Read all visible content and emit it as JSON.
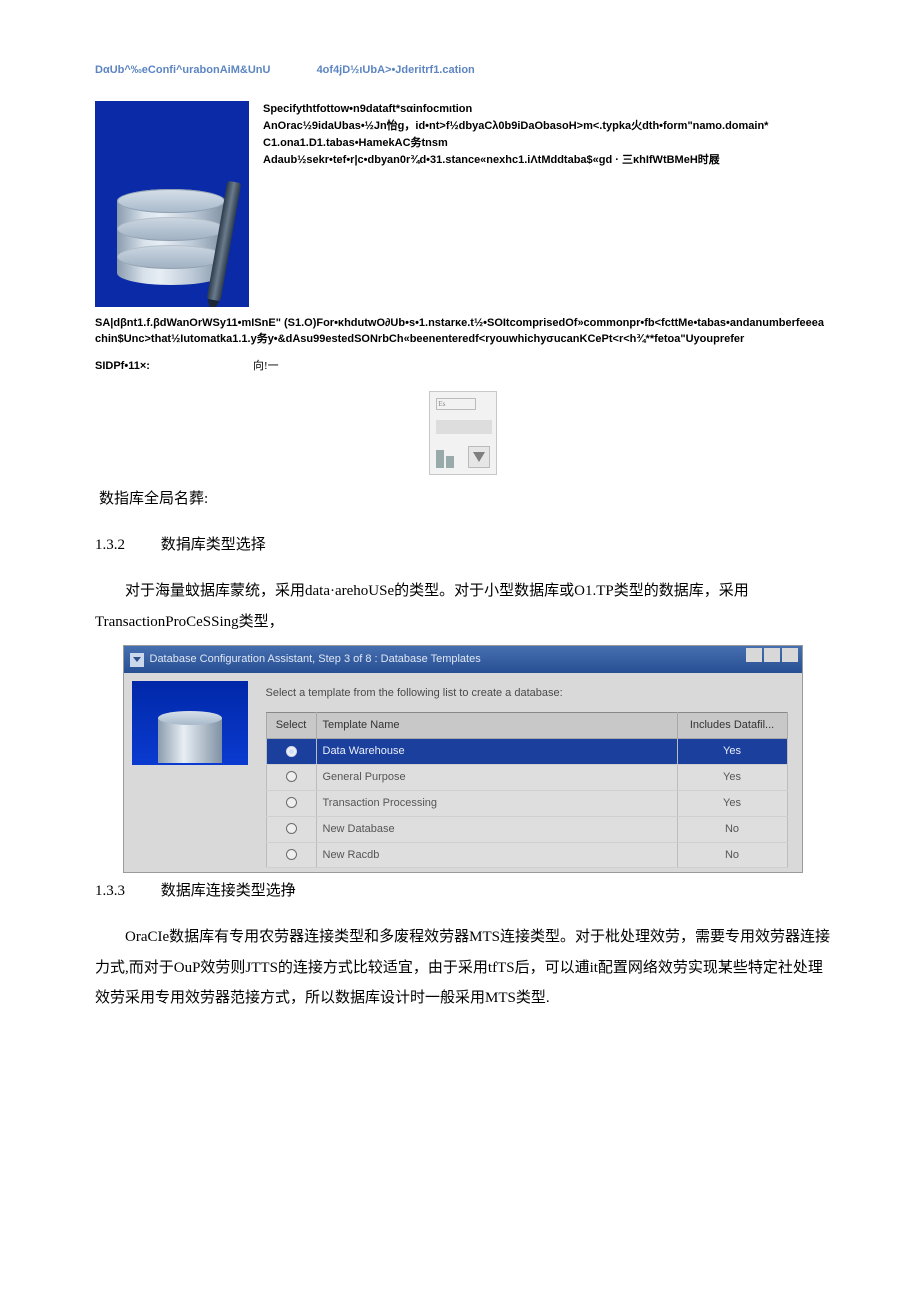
{
  "header": {
    "left": "DαUb^‰eConfi^urabonAiM&UnU",
    "right": "4of4jD½ιUbA>•Jderitrf1.cation"
  },
  "spec": {
    "l1": "Specifythtfottow•n9dataft*sαinfocmιtion",
    "l2": "AnOrac½9idaUbas•½Jn怡g，id•nt>f½dbyaCλ0b9iDaObasoH>m<.typka火dth•form\"namo.domain*",
    "l3": "C1.ona1.D1.tabas•HamekAC务tnsm",
    "l4": "Adaub½sekr•tef•r|c•dbyan0r¾d•31.stance«nexhc1.iΛtMddtaba$«gd · 三κhIfWtBMeH时屐"
  },
  "garble2": {
    "l1": "SA|dβnt1.f.βdWanOrWSy11•mISnE\"  (S1.O)For•κhdutwO∂Ub•s•1.nstarκe.t½•SOItcomprisedOf»commonpr•fb<fcttMe•tabas•andanumberfeeeachin$Unc>that½Iutomatka1.1.y务y•&dΑsu99estedSONrbCh«beenenteredf<ryouwhichyσucanKCePt<r<h¾**fetoa\"Uyouprefer"
  },
  "sid": {
    "label": "SIDPf•11×:",
    "cn": "向!一"
  },
  "label1": "数指库全局名葬:",
  "sec132": {
    "num": "1.3.2",
    "title": "数捐库类型选择"
  },
  "para1": "对于海量蚊据库蒙统，采用data·arehoUSe的类型。对于小型数据库或O1.TP类型的数据库，采用TransactionProCeSSing类型，",
  "dbca": {
    "title": "Database Configuration Assistant, Step 3 of 8 : Database Templates",
    "caption": "Select a template from the following list to create a database:",
    "cols": {
      "select": "Select",
      "name": "Template Name",
      "includes": "Includes Datafil..."
    },
    "rows": [
      {
        "selected": true,
        "name": "Data Warehouse",
        "includes": "Yes"
      },
      {
        "selected": false,
        "name": "General Purpose",
        "includes": "Yes"
      },
      {
        "selected": false,
        "name": "Transaction Processing",
        "includes": "Yes"
      },
      {
        "selected": false,
        "name": "New Database",
        "includes": "No"
      },
      {
        "selected": false,
        "name": "New Racdb",
        "includes": "No"
      }
    ]
  },
  "sec133": {
    "num": "1.3.3",
    "title": "数据库连接类型选挣"
  },
  "para2": "OraCIe数据库有专用农劳器连接类型和多废程效劳器MTS连接类型。对于枇处理效劳，需要专用效劳器连接力式,而对于OuP效劳则JTTS的连接方式比较适宜，由于采用tfTS后，可以逋it配置网络效劳实现某些特定社处理效劳采用专用效劳器范接方式，所以数据库设计时一般采用MTS类型."
}
